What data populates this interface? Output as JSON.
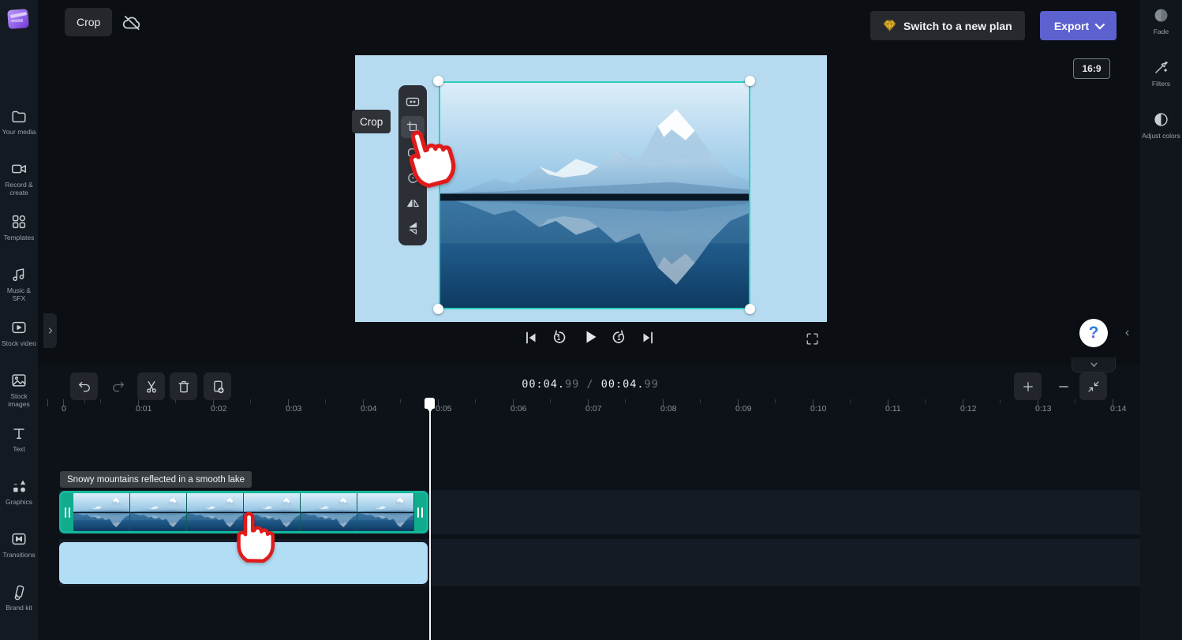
{
  "app": {
    "name": "Clipchamp",
    "logo_icon": "clipchamp-logo"
  },
  "topbar": {
    "title": "Crop",
    "cloud_icon": "cloud-backup-off-icon",
    "switch_plan_label": "Switch to a new plan",
    "export_label": "Export"
  },
  "left_sidebar": {
    "items": [
      {
        "label": "Your media",
        "icon": "folder-media-icon"
      },
      {
        "label": "Record & create",
        "icon": "record-create-icon"
      },
      {
        "label": "Templates",
        "icon": "templates-icon"
      },
      {
        "label": "Music & SFX",
        "icon": "music-sfx-icon"
      },
      {
        "label": "Stock video",
        "icon": "stock-video-icon"
      },
      {
        "label": "Stock images",
        "icon": "stock-images-icon"
      },
      {
        "label": "Text",
        "icon": "text-icon"
      },
      {
        "label": "Graphics",
        "icon": "graphics-icon"
      },
      {
        "label": "Transitions",
        "icon": "transitions-icon"
      },
      {
        "label": "Brand kit",
        "icon": "brand-kit-icon"
      }
    ]
  },
  "right_sidebar": {
    "items": [
      {
        "label": "Fade",
        "icon": "fade-icon"
      },
      {
        "label": "Filters",
        "icon": "filters-icon"
      },
      {
        "label": "Adjust colors",
        "icon": "adjust-colors-icon"
      }
    ]
  },
  "preview": {
    "aspect_ratio": "16:9",
    "crop_tooltip": "Crop",
    "toolbar_icons": [
      "fit-frame-icon",
      "crop-icon",
      "rounded-corners-icon",
      "rotate-icon",
      "flip-horizontal-icon",
      "flip-vertical-icon"
    ],
    "transport_icons": [
      "skip-start-icon",
      "rewind-1s-icon",
      "play-icon",
      "forward-1s-icon",
      "skip-end-icon",
      "fullscreen-icon"
    ]
  },
  "timeline": {
    "toolbar_icons": [
      "undo-icon",
      "redo-icon",
      "split-icon",
      "delete-icon",
      "duplicate-icon"
    ],
    "timecode": {
      "current_main": "00:04.",
      "current_frac": "99",
      "separator": "/",
      "total_main": "00:04.",
      "total_frac": "99"
    },
    "zoom_controls": [
      "zoom-in-icon",
      "zoom-out-icon",
      "zoom-fit-icon"
    ],
    "ruler_labels": [
      "0",
      "0:01",
      "0:02",
      "0:03",
      "0:04",
      "0:05",
      "0:06",
      "0:07",
      "0:08",
      "0:09",
      "0:10",
      "0:11",
      "0:12",
      "0:13",
      "0:14"
    ],
    "clip_label": "Snowy mountains reflected in a smooth lake"
  },
  "help": {
    "label": "?"
  },
  "colors": {
    "accent": "#5d61cf",
    "selection_teal": "#14b89b",
    "canvas_blue": "#b6dbf0",
    "secondary_clip_blue": "#b2def5",
    "gem_yellow": "#e9b832",
    "tutorial_cursor_red": "#e01b1b"
  }
}
